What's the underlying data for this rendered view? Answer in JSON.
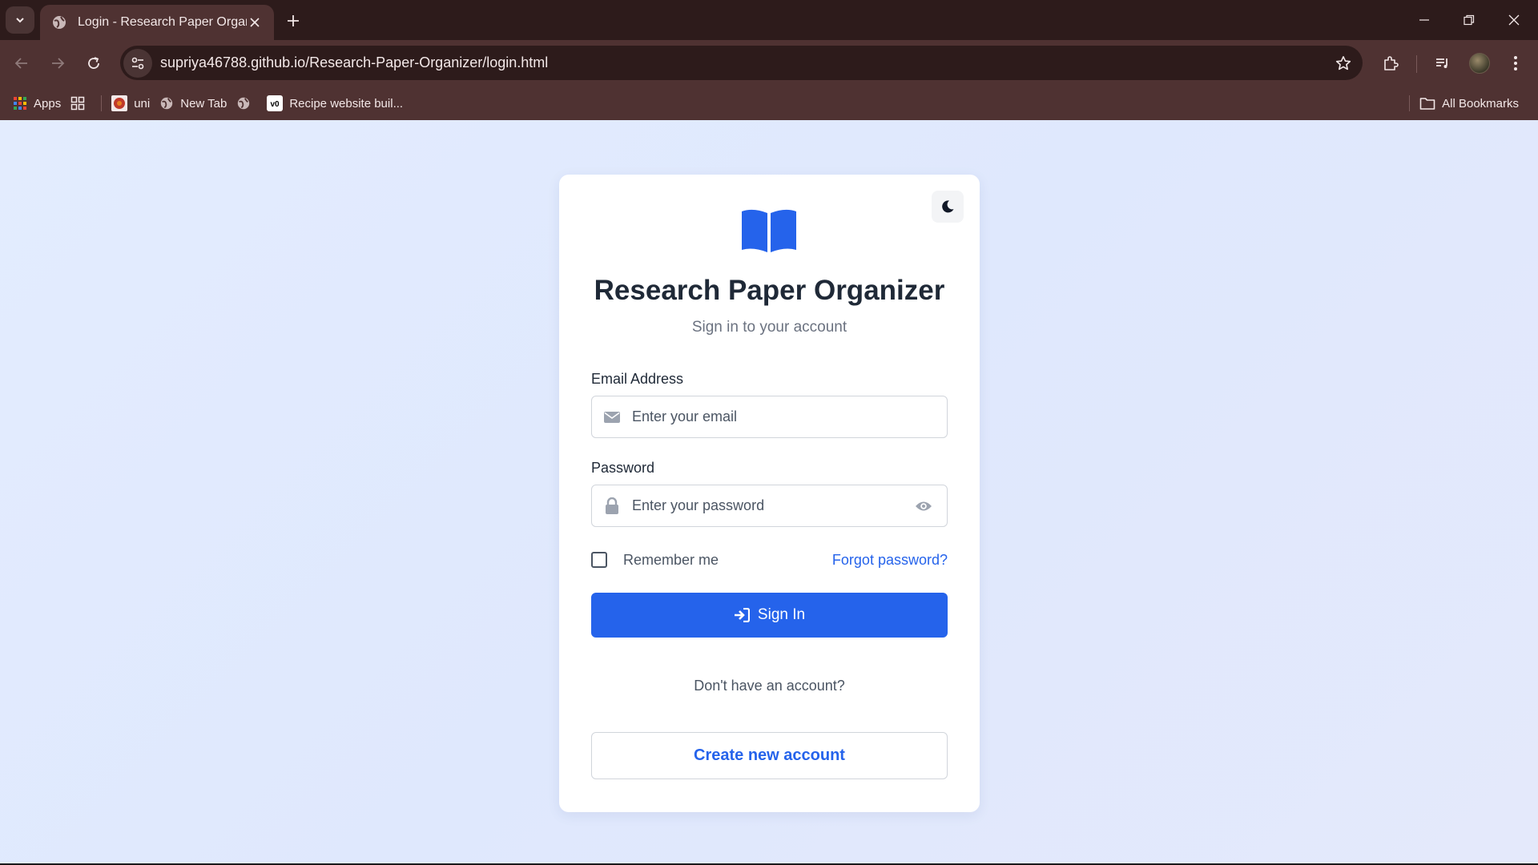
{
  "browser": {
    "tab_title": "Login - Research Paper Organiz",
    "url": "supriya46788.github.io/Research-Paper-Organizer/login.html",
    "bookmarks": [
      {
        "label": "Apps",
        "icon": "apps-grid-icon"
      },
      {
        "label": "",
        "icon": "tab-groups-icon"
      },
      {
        "label": "uni",
        "icon": "uni-favicon"
      },
      {
        "label": "New Tab",
        "icon": "globe-icon"
      },
      {
        "label": "",
        "icon": "globe-icon"
      },
      {
        "label": "Recipe website buil...",
        "icon": "v0-favicon"
      }
    ],
    "all_bookmarks_label": "All Bookmarks"
  },
  "card": {
    "title": "Research Paper Organizer",
    "subtitle": "Sign in to your account",
    "email_label": "Email Address",
    "email_placeholder": "Enter your email",
    "password_label": "Password",
    "password_placeholder": "Enter your password",
    "remember_label": "Remember me",
    "forgot_label": "Forgot password?",
    "signin_label": "Sign In",
    "no_account_text": "Don't have an account?",
    "create_label": "Create new account"
  },
  "colors": {
    "accent": "#2563eb",
    "chrome_dark": "#2d1b1b",
    "chrome_bar": "#4f3232",
    "page_bg": "#dde8fd"
  }
}
